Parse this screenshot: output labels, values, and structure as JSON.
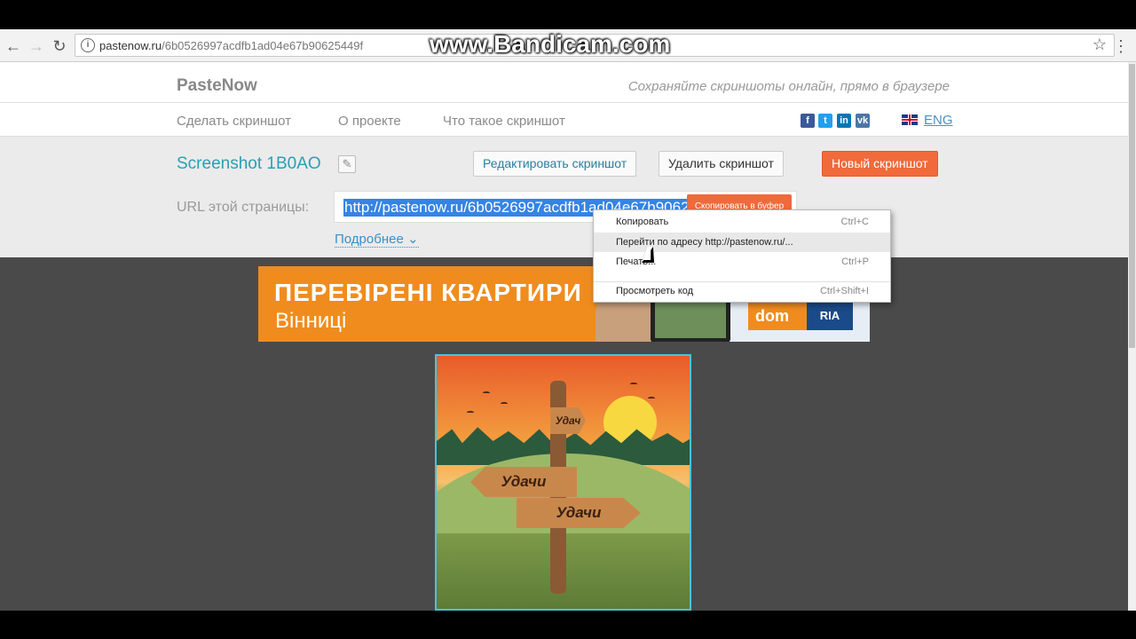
{
  "browser": {
    "url_host": "pastenow.ru",
    "url_path": "/6b0526997acdfb1ad04e67b90625449f"
  },
  "watermark": "www.Bandicam.com",
  "site": {
    "logo": "PasteNow",
    "tagline": "Сохраняйте скриншоты онлайн, прямо в браузере",
    "menu": [
      "Сделать скриншот",
      "О проекте",
      "Что такое скриншот"
    ],
    "social": [
      "facebook-icon",
      "twitter-icon",
      "linkedin-icon",
      "vk-icon"
    ],
    "lang": "ENG"
  },
  "screenshot": {
    "title": "Screenshot 1B0AO",
    "edit_label": "Редактировать скриншот",
    "delete_label": "Удалить скриншот",
    "new_label": "Новый скриншот",
    "url_label": "URL этой страницы:",
    "url_value": "http://pastenow.ru/6b0526997acdfb1ad04e67b90625449f",
    "copy_label": "Скопировать в буфер",
    "more_label": "Подробнее"
  },
  "banner": {
    "headline": "ПЕРЕВІРЕНІ КВАРТИРИ",
    "city": "Вінниці",
    "brand_left": "dom",
    "brand_right": "RIA"
  },
  "image": {
    "sign_top": "Удач",
    "sign_left": "Удачи",
    "sign_right": "Удачи"
  },
  "context_menu": {
    "items": [
      {
        "label": "Копировать",
        "shortcut": "Ctrl+C"
      },
      {
        "label": "Перейти по адресу http://pastenow.ru/...",
        "shortcut": ""
      },
      {
        "label": "Печать...",
        "shortcut": "Ctrl+P"
      },
      {
        "label": "Просмотреть код",
        "shortcut": "Ctrl+Shift+I"
      }
    ]
  }
}
